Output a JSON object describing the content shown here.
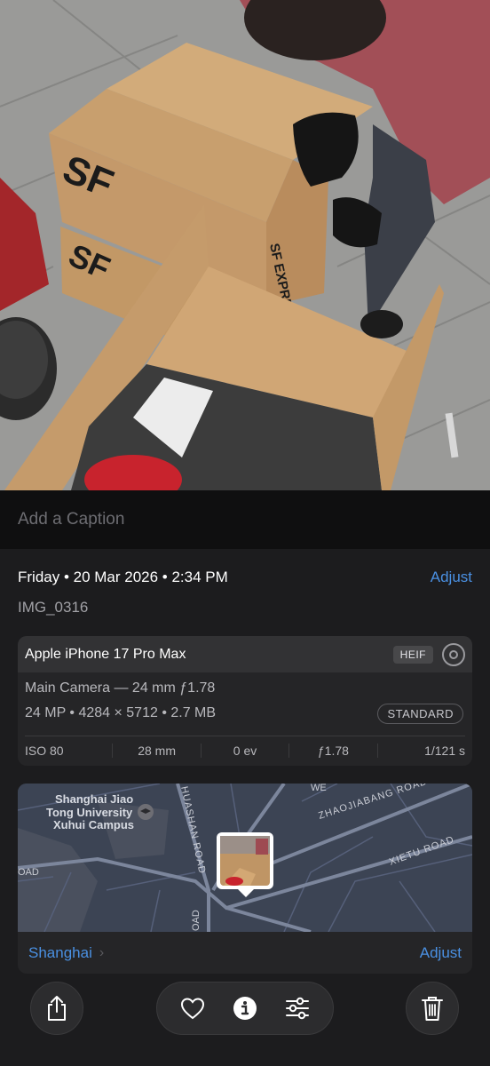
{
  "caption": {
    "placeholder": "Add a Caption"
  },
  "info": {
    "date": "Friday • 20 Mar 2026 • 2:34 PM",
    "adjust_label": "Adjust",
    "filename": "IMG_0316"
  },
  "camera": {
    "device": "Apple iPhone 17 Pro Max",
    "format_badge": "HEIF",
    "lens": "Main Camera — 24 mm ƒ1.78",
    "details": "24 MP • 4284 × 5712 • 2.7 MB",
    "style_badge": "STANDARD",
    "exif": [
      "ISO 80",
      "28 mm",
      "0 ev",
      "ƒ1.78",
      "1/121 s"
    ]
  },
  "map": {
    "labels": {
      "campus": [
        "Shanghai Jiao",
        "Tong University",
        "Xuhui Campus"
      ],
      "huashan": "HUASHAN ROAD",
      "zhaojiabang": "ZHAOJIABANG ROAD",
      "xietu": "XIETU ROAD",
      "we": "WE",
      "oad": "OAD",
      "oad2": "OAD"
    },
    "location": "Shanghai",
    "adjust_label": "Adjust"
  },
  "photo": {
    "box_text": "SF EXPRESS",
    "logo": "SF"
  },
  "toolbar": {
    "icons": [
      "share-icon",
      "heart-icon",
      "info-icon",
      "adjust-icon",
      "trash-icon"
    ]
  }
}
